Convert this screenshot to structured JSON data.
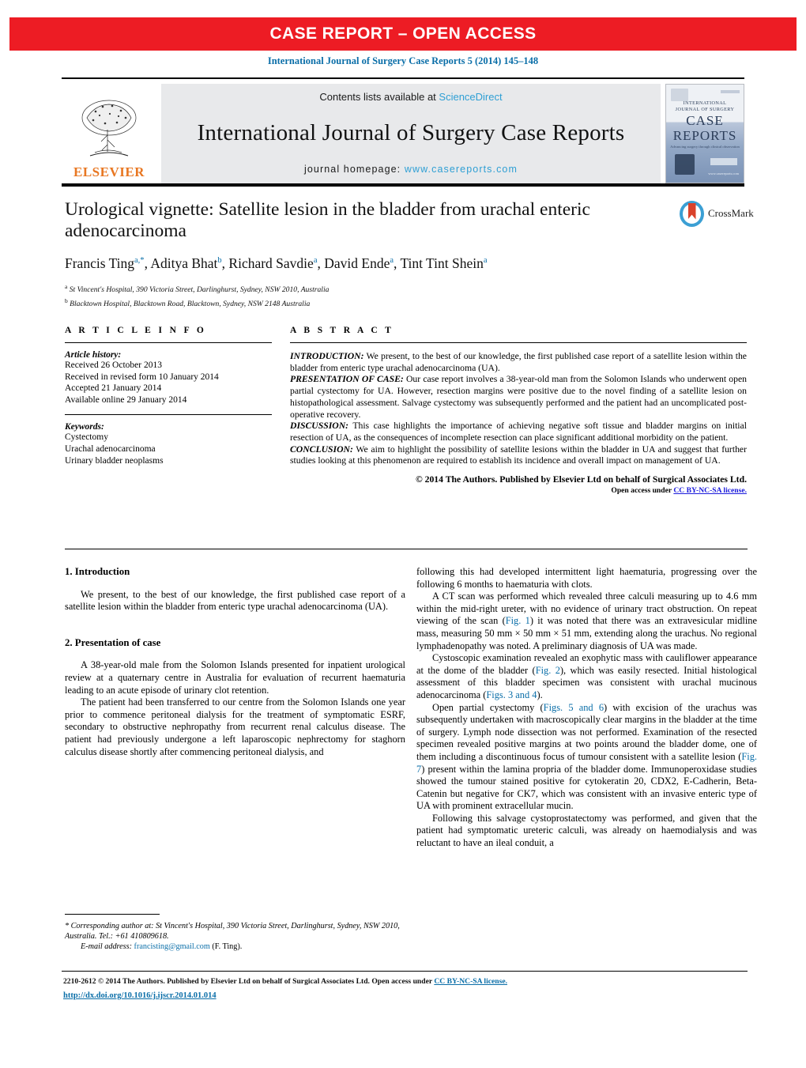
{
  "banner": {
    "text": "CASE REPORT – OPEN ACCESS"
  },
  "citation": "International Journal of Surgery Case Reports 5 (2014) 145–148",
  "masthead": {
    "elsevier_word": "ELSEVIER",
    "contents_prefix": "Contents lists available at ",
    "contents_link": "ScienceDirect",
    "journal_title": "International Journal of Surgery Case Reports",
    "homepage_prefix": "journal homepage: ",
    "homepage_url": "www.casereports.com",
    "cover": {
      "line1": "INTERNATIONAL",
      "line2": "JOURNAL OF SURGERY",
      "case": "CASE",
      "reports": "REPORTS",
      "subtitle": "Advancing surgery through clinical observation",
      "url": "www.casereports.com"
    }
  },
  "article": {
    "title": "Urological vignette: Satellite lesion in the bladder from urachal enteric adenocarcinoma",
    "authors_html": "Francis Ting<sup>a,*</sup>, Aditya Bhat<sup>b</sup>, Richard Savdie<sup>a</sup>, David Ende<sup>a</sup>, Tint Tint Shein<sup>a</sup>",
    "affiliation_a": "St Vincent's Hospital, 390 Victoria Street, Darlinghurst, Sydney, NSW 2010, Australia",
    "affiliation_b": "Blacktown Hospital, Blacktown Road, Blacktown, Sydney, NSW 2148 Australia",
    "crossmark_label": "CrossMark"
  },
  "article_info": {
    "heading": "A R T I C L E   I N F O",
    "history_label": "Article history:",
    "history": [
      "Received 26 October 2013",
      "Received in revised form 10 January 2014",
      "Accepted 21 January 2014",
      "Available online 29 January 2014"
    ],
    "keywords_label": "Keywords:",
    "keywords": [
      "Cystectomy",
      "Urachal adenocarcinoma",
      "Urinary bladder neoplasms"
    ]
  },
  "abstract": {
    "heading": "A B S T R A C T",
    "sections": [
      {
        "label": "INTRODUCTION:",
        "text": " We present, to the best of our knowledge, the first published case report of a satellite lesion within the bladder from enteric type urachal adenocarcinoma (UA)."
      },
      {
        "label": "PRESENTATION OF CASE:",
        "text": " Our case report involves a 38-year-old man from the Solomon Islands who underwent open partial cystectomy for UA. However, resection margins were positive due to the novel finding of a satellite lesion on histopathological assessment. Salvage cystectomy was subsequently performed and the patient had an uncomplicated post-operative recovery."
      },
      {
        "label": "DISCUSSION:",
        "text": " This case highlights the importance of achieving negative soft tissue and bladder margins on initial resection of UA, as the consequences of incomplete resection can place significant additional morbidity on the patient."
      },
      {
        "label": "CONCLUSION:",
        "text": " We aim to highlight the possibility of satellite lesions within the bladder in UA and suggest that further studies looking at this phenomenon are required to establish its incidence and overall impact on management of UA."
      }
    ],
    "copyright": "© 2014 The Authors. Published by Elsevier Ltd on behalf of Surgical Associates Ltd.",
    "license_prefix": "Open access under ",
    "license_link": "CC BY-NC-SA license."
  },
  "body": {
    "section1_heading": "1.  Introduction",
    "section1_para": "We present, to the best of our knowledge, the first published case report of a satellite lesion within the bladder from enteric type urachal adenocarcinoma (UA).",
    "section2_heading": "2.  Presentation of case",
    "left_para1": "A 38-year-old male from the Solomon Islands presented for inpatient urological review at a quaternary centre in Australia for evaluation of recurrent haematuria leading to an acute episode of urinary clot retention.",
    "left_para2": "The patient had been transferred to our centre from the Solomon Islands one year prior to commence peritoneal dialysis for the treatment of symptomatic ESRF, secondary to obstructive nephropathy from recurrent renal calculus disease. The patient had previously undergone a left laparoscopic nephrectomy for staghorn calculus disease shortly after commencing peritoneal dialysis, and",
    "right_para1_cont": "following this had developed intermittent light haematuria, progressing over the following 6 months to haematuria with clots.",
    "right_para2_a": "A CT scan was performed which revealed three calculi measuring up to 4.6 mm within the mid-right ureter, with no evidence of urinary tract obstruction. On repeat viewing of the scan (",
    "right_para2_ref1": "Fig. 1",
    "right_para2_b": ") it was noted that there was an extravesicular midline mass, measuring 50 mm × 50 mm × 51 mm, extending along the urachus. No regional lymphadenopathy was noted. A preliminary diagnosis of UA was made.",
    "right_para3_a": "Cystoscopic examination revealed an exophytic mass with cauliflower appearance at the dome of the bladder (",
    "right_para3_ref1": "Fig. 2",
    "right_para3_b": "), which was easily resected. Initial histological assessment of this bladder specimen was consistent with urachal mucinous adenocarcinoma (",
    "right_para3_ref2": "Figs. 3 and 4",
    "right_para3_c": ").",
    "right_para4_a": "Open partial cystectomy (",
    "right_para4_ref1": "Figs. 5 and 6",
    "right_para4_b": ") with excision of the urachus was subsequently undertaken with macroscopically clear margins in the bladder at the time of surgery. Lymph node dissection was not performed. Examination of the resected specimen revealed positive margins at two points around the bladder dome, one of them including a discontinuous focus of tumour consistent with a satellite lesion (",
    "right_para4_ref2": "Fig. 7",
    "right_para4_c": ") present within the lamina propria of the bladder dome. Immunoperoxidase studies showed the tumour stained positive for cytokeratin 20, CDX2, E-Cadherin, Beta-Catenin but negative for CK7, which was consistent with an invasive enteric type of UA with prominent extracellular mucin.",
    "right_para5": "Following this salvage cystoprostatectomy was performed, and given that the patient had symptomatic ureteric calculi, was already on haemodialysis and was reluctant to have an ileal conduit, a"
  },
  "footnote": {
    "corresponding": "* Corresponding author at: St Vincent's Hospital, 390 Victoria Street, Darlinghurst, Sydney, NSW 2010, Australia. Tel.: +61 410809618.",
    "email_label": "E-mail address:",
    "email": "francisting@gmail.com",
    "email_suffix": "(F. Ting)."
  },
  "footer": {
    "issn_copyright": "2210-2612 © 2014 The Authors. Published by Elsevier Ltd on behalf of Surgical Associates Ltd. Open access under ",
    "license_link": "CC BY-NC-SA license.",
    "doi": "http://dx.doi.org/10.1016/j.ijscr.2014.01.014"
  },
  "colors": {
    "banner_red": "#ED1C24",
    "link_blue": "#0a6ea8",
    "elsevier_orange": "#E87722",
    "band_grey": "#e8e9eb"
  }
}
